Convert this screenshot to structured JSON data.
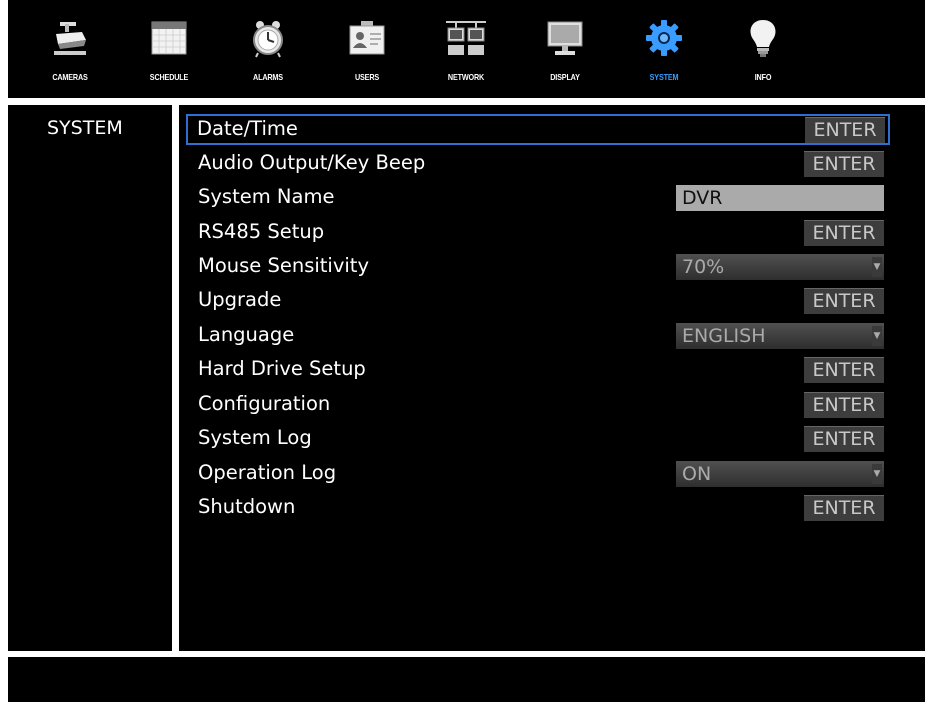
{
  "nav": {
    "tabs": [
      {
        "label": "CAMERAS",
        "icon": "camera-icon"
      },
      {
        "label": "SCHEDULE",
        "icon": "calendar-icon"
      },
      {
        "label": "ALARMS",
        "icon": "alarm-clock-icon"
      },
      {
        "label": "USERS",
        "icon": "id-card-icon"
      },
      {
        "label": "NETWORK",
        "icon": "network-icon"
      },
      {
        "label": "DISPLAY",
        "icon": "monitor-icon"
      },
      {
        "label": "SYSTEM",
        "icon": "gear-icon",
        "active": true
      },
      {
        "label": "INFO",
        "icon": "lightbulb-icon"
      }
    ]
  },
  "section": {
    "title": "SYSTEM"
  },
  "settings": {
    "date_time": {
      "label": "Date/Time",
      "button": "ENTER"
    },
    "audio": {
      "label": "Audio Output/Key Beep",
      "button": "ENTER"
    },
    "system_name": {
      "label": "System Name",
      "value": "DVR"
    },
    "rs485": {
      "label": "RS485 Setup",
      "button": "ENTER"
    },
    "mouse": {
      "label": "Mouse Sensitivity",
      "value": "70%"
    },
    "upgrade": {
      "label": "Upgrade",
      "button": "ENTER"
    },
    "language": {
      "label": "Language",
      "value": "ENGLISH"
    },
    "hdd": {
      "label": "Hard Drive Setup",
      "button": "ENTER"
    },
    "config": {
      "label": "Configuration",
      "button": "ENTER"
    },
    "syslog": {
      "label": "System Log",
      "button": "ENTER"
    },
    "oplog": {
      "label": "Operation Log",
      "value": "ON"
    },
    "shutdown": {
      "label": "Shutdown",
      "button": "ENTER"
    }
  },
  "colors": {
    "accent": "#3a9cff",
    "selection_outline": "#2f6fcf",
    "button_bg": "#3d3d3d"
  }
}
